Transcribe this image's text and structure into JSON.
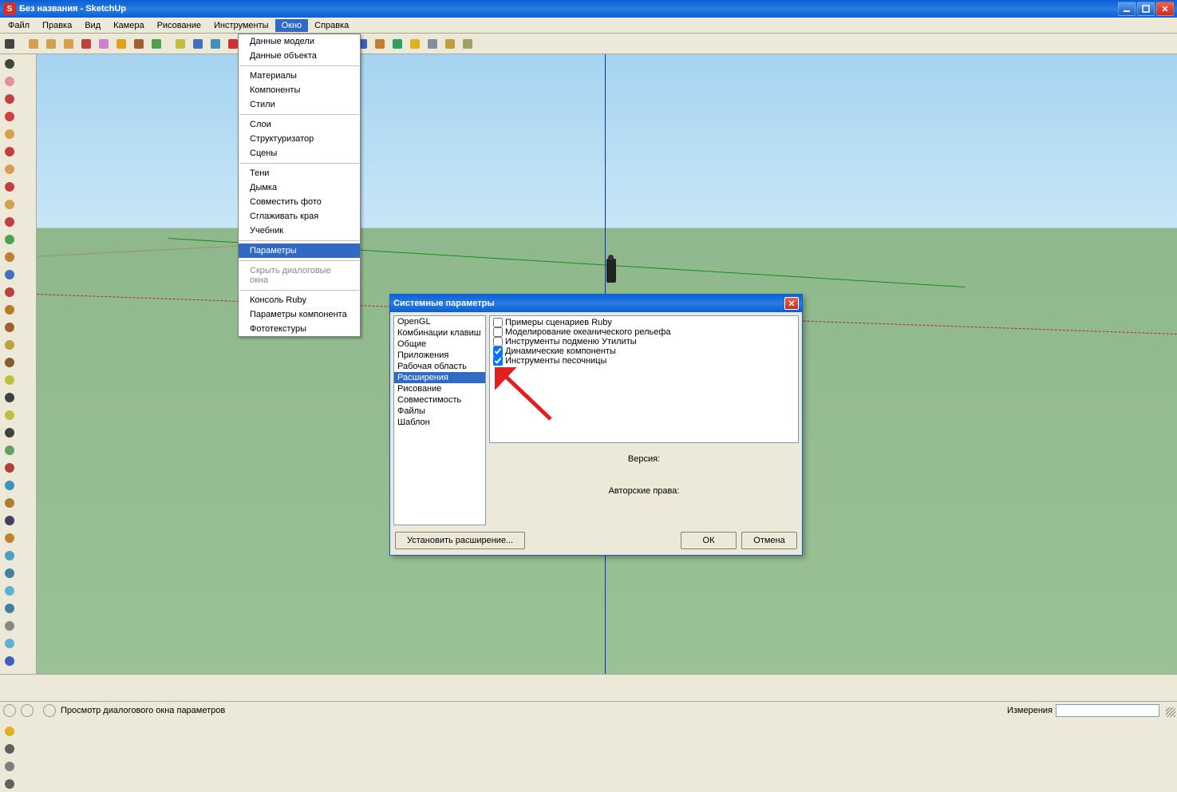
{
  "window": {
    "title": "Без названия - SketchUp"
  },
  "menu": {
    "items": [
      "Файл",
      "Правка",
      "Вид",
      "Камера",
      "Рисование",
      "Инструменты",
      "Окно",
      "Справка"
    ],
    "open_index": 6
  },
  "dropdown": {
    "groups": [
      [
        "Данные модели",
        "Данные объекта"
      ],
      [
        "Материалы",
        "Компоненты",
        "Стили"
      ],
      [
        "Слои",
        "Структуризатор",
        "Сцены"
      ],
      [
        "Тени",
        "Дымка",
        "Совместить фото",
        "Сглаживать края",
        "Учебник"
      ],
      [
        "Параметры"
      ],
      [
        "Скрыть диалоговые окна"
      ],
      [
        "Консоль Ruby",
        "Параметры компонента",
        "Фототекстуры"
      ]
    ],
    "highlighted": "Параметры",
    "disabled": "Скрыть диалоговые окна"
  },
  "toolbar_top_icons": [
    "select",
    "pencil",
    "rect",
    "circle",
    "arc",
    "push",
    "move",
    "rotate",
    "scale",
    "tape",
    "text",
    "paint",
    "eraser",
    "orbit",
    "pan",
    "zoom",
    "zoomext",
    "prev",
    "next",
    "iso",
    "person",
    "globe",
    "sun",
    "layers",
    "dims",
    "walk"
  ],
  "side_icons": [
    "select",
    "eraser",
    "pencil",
    "line",
    "rect",
    "rect2",
    "circle",
    "circ2",
    "poly",
    "arc",
    "push",
    "follow",
    "move",
    "move2",
    "rotate",
    "scale",
    "offset",
    "curve",
    "tape",
    "text",
    "dims",
    "dims2",
    "protractor",
    "axes",
    "paint",
    "paint2",
    "section",
    "section2",
    "camera",
    "walk",
    "orbit",
    "pan",
    "lookaround",
    "zoom",
    "zoomwin",
    "zoomext",
    "prev",
    "iso",
    "sun",
    "shadow",
    "xray",
    "wire"
  ],
  "dialog": {
    "title": "Системные параметры",
    "categories": [
      "OpenGL",
      "Комбинации клавиш",
      "Общие",
      "Приложения",
      "Рабочая область",
      "Расширения",
      "Рисование",
      "Совместимость",
      "Файлы",
      "Шаблон"
    ],
    "selected_category": "Расширения",
    "extensions": [
      {
        "label": "Примеры сценариев Ruby",
        "checked": false
      },
      {
        "label": "Моделирование океанического рельефа",
        "checked": false
      },
      {
        "label": "Инструменты подменю Утилиты",
        "checked": false
      },
      {
        "label": "Динамические компоненты",
        "checked": true
      },
      {
        "label": "Инструменты песочницы",
        "checked": true
      }
    ],
    "info": {
      "version_label": "Версия:",
      "copyright_label": "Авторские права:"
    },
    "buttons": {
      "install": "Установить расширение...",
      "ok": "ОК",
      "cancel": "Отмена"
    }
  },
  "statusbar": {
    "hint": "Просмотр диалогового окна параметров",
    "measurement_label": "Измерения"
  }
}
